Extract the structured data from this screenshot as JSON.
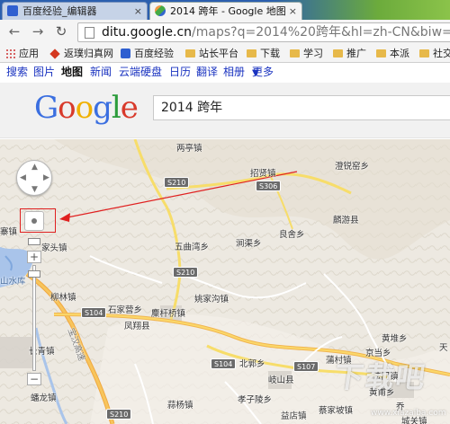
{
  "tabs": [
    {
      "label": "百度经验_编辑器",
      "close": "×"
    },
    {
      "label": "2014 跨年 - Google 地图",
      "close": "×"
    }
  ],
  "toolbar": {
    "back": "←",
    "forward": "→",
    "reload": "↻",
    "url_domain": "ditu.google.cn",
    "url_path": "/maps?q=2014%20跨年&hl=zh-CN&biw=8"
  },
  "bookmarks": [
    "应用",
    "返璞归真网",
    "百度经验",
    "站长平台",
    "下载",
    "学习",
    "推广",
    "本派",
    "社交"
  ],
  "google_nav": {
    "items": [
      "搜索",
      "图片",
      "地图",
      "新闻",
      "云端硬盘",
      "日历",
      "翻译",
      "相册",
      "更多"
    ],
    "selected": "地图",
    "more_arrow": "▼"
  },
  "header": {
    "logo": [
      "G",
      "o",
      "o",
      "g",
      "l",
      "e"
    ],
    "search_value": "2014 跨年"
  },
  "map": {
    "places": [
      "两亭镇",
      "招贤镇",
      "澄锐窑乡",
      "麟游县",
      "良舍乡",
      "五曲湾乡",
      "涧渠乡",
      "石家营乡",
      "姚家沟镇",
      "柳林镇",
      "麇杆桥镇",
      "凤翔县",
      "北郭乡",
      "岐山县",
      "京当乡",
      "孝子陵乡",
      "蒲村镇",
      "黄堆乡",
      "法门镇",
      "黄甫乡",
      "天",
      "城关镇",
      "蔡家坡镇",
      "长青镇",
      "蟠龙镇",
      "家头镇",
      "寨镇",
      "山水库",
      "宝汉高速",
      "蒜杨镇",
      "益店镇",
      "乔"
    ],
    "roads": [
      "S210",
      "S306",
      "S210",
      "S104",
      "S104",
      "S107",
      "S210"
    ],
    "controls": {
      "zoom_in": "+",
      "zoom_out": "−"
    },
    "watermark": "下载吧",
    "watermark_sub": "www.xiazaiba.com"
  }
}
